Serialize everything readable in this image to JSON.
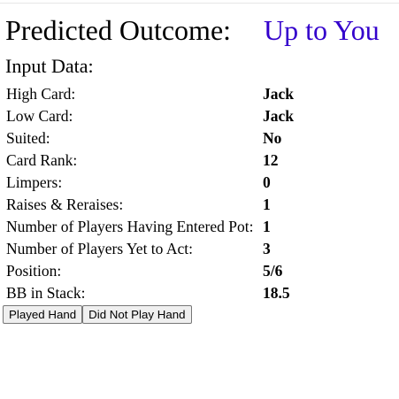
{
  "outcome": {
    "label": "Predicted Outcome:",
    "value": "Up to You",
    "value_color": "#3300cc"
  },
  "input_heading": "Input Data:",
  "rows": [
    {
      "label": "High Card:",
      "value": "Jack"
    },
    {
      "label": "Low Card:",
      "value": "Jack"
    },
    {
      "label": "Suited:",
      "value": "No"
    },
    {
      "label": "Card Rank:",
      "value": "12"
    },
    {
      "label": "Limpers:",
      "value": "0"
    },
    {
      "label": "Raises & Reraises:",
      "value": "1"
    },
    {
      "label": "Number of Players Having Entered Pot:",
      "value": "1"
    },
    {
      "label": "Number of Players Yet to Act:",
      "value": "3"
    },
    {
      "label": "Position:",
      "value": "5/6"
    },
    {
      "label": "BB in Stack:",
      "value": "18.5"
    }
  ],
  "buttons": {
    "played": "Played Hand",
    "not_played": "Did Not Play Hand"
  }
}
